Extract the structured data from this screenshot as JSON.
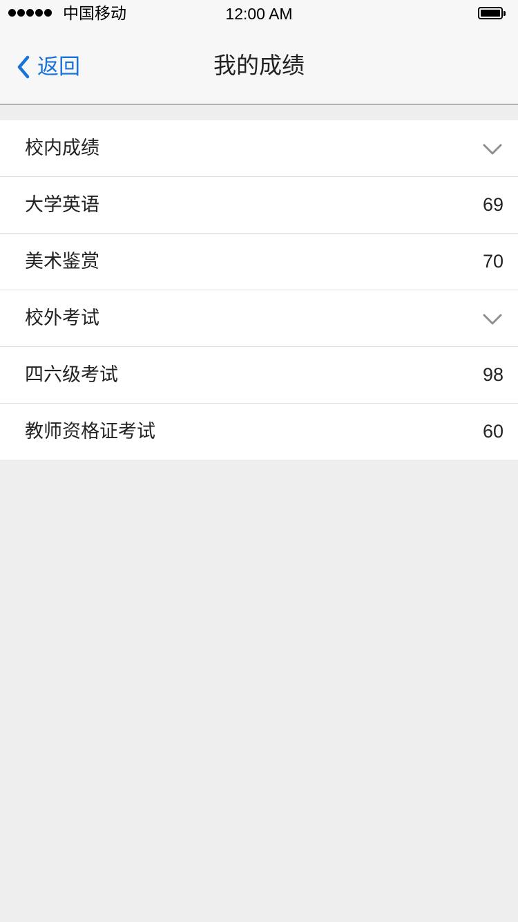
{
  "status_bar": {
    "carrier": "中国移动",
    "time": "12:00 AM",
    "signal_icon": "signal-dots-icon",
    "battery_icon": "battery-full-icon"
  },
  "nav": {
    "back_label": "返回",
    "back_icon": "chevron-left-icon",
    "title": "我的成绩",
    "accent_color": "#1a73d9"
  },
  "sections": [
    {
      "title": "校内成绩",
      "expand_icon": "chevron-down-icon",
      "items": [
        {
          "name": "大学英语",
          "score": "69"
        },
        {
          "name": "美术鉴赏",
          "score": "70"
        }
      ]
    },
    {
      "title": "校外考试",
      "expand_icon": "chevron-down-icon",
      "items": [
        {
          "name": "四六级考试",
          "score": "98"
        },
        {
          "name": "教师资格证考试",
          "score": "60"
        }
      ]
    }
  ],
  "colors": {
    "background": "#eeeeee",
    "list_background": "#ffffff",
    "nav_background": "#f7f7f7"
  }
}
